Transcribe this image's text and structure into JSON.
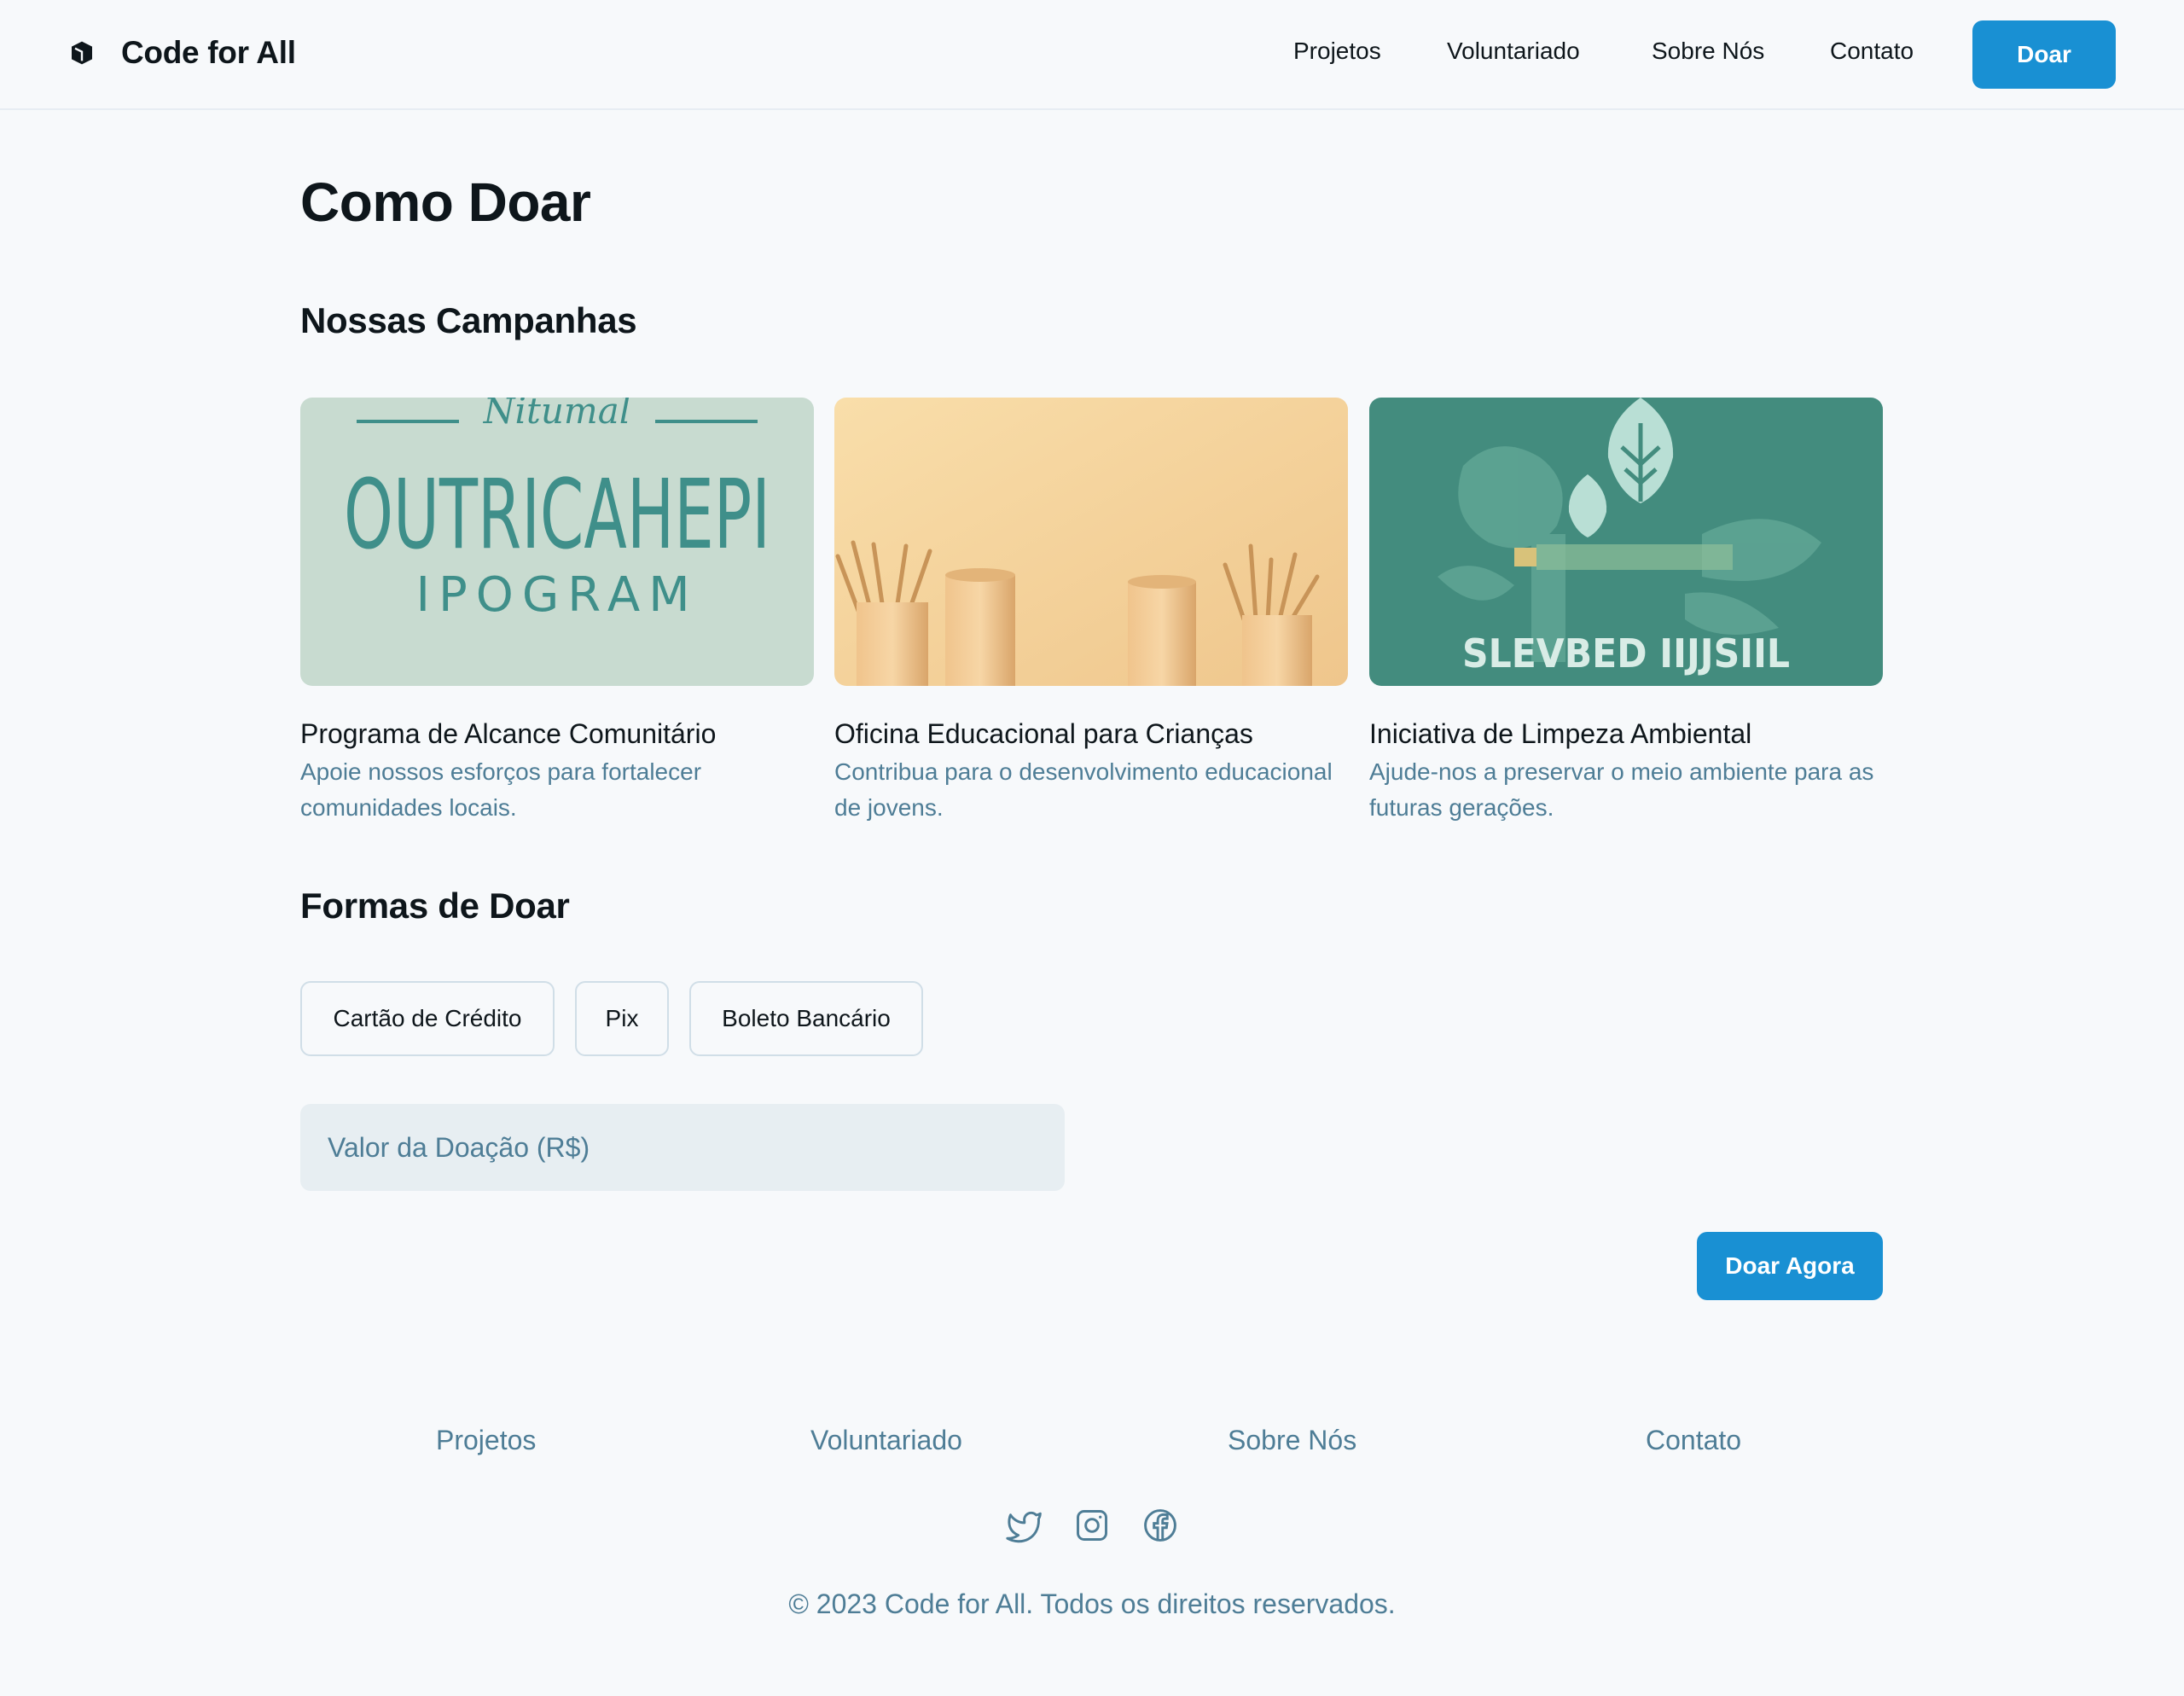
{
  "header": {
    "brand": "Code for All",
    "nav": [
      "Projetos",
      "Voluntariado",
      "Sobre Nós",
      "Contato"
    ],
    "donate_label": "Doar"
  },
  "page": {
    "title": "Como Doar"
  },
  "campaigns": {
    "section_title": "Nossas Campanhas",
    "items": [
      {
        "title": "Programa de Alcance Comunitário",
        "description": "Apoie nossos esforços para fortalecer comunidades locais.",
        "image_text": {
          "top": "Nitumal",
          "main": "OUTRICAHEPI",
          "sub": "IPOGRAM"
        }
      },
      {
        "title": "Oficina Educacional para Crianças",
        "description": "Contribua para o desenvolvimento educacional de jovens."
      },
      {
        "title": "Iniciativa de Limpeza Ambiental",
        "description": "Ajude-nos a preservar o meio ambiente para as futuras gerações.",
        "image_text": {
          "main": "SLEVBED IIJJSIIL"
        }
      }
    ]
  },
  "payment": {
    "section_title": "Formas de Doar",
    "methods": [
      "Cartão de Crédito",
      "Pix",
      "Boleto Bancário"
    ],
    "amount_placeholder": "Valor da Doação (R$)",
    "amount_value": "",
    "submit_label": "Doar Agora"
  },
  "footer": {
    "links": [
      "Projetos",
      "Voluntariado",
      "Sobre Nós",
      "Contato"
    ],
    "social": [
      "twitter-icon",
      "instagram-icon",
      "facebook-icon"
    ],
    "copyright": "© 2023 Code for All. Todos os direitos reservados."
  },
  "colors": {
    "accent": "#1990d3",
    "muted_text": "#4e7d96",
    "background": "#f7f9fb",
    "input_bg": "#e7eef2"
  }
}
